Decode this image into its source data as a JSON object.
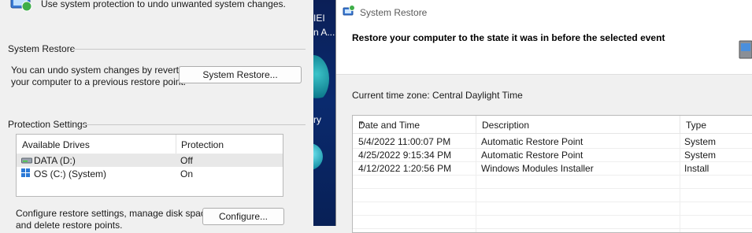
{
  "sysprops": {
    "intro": "Use system protection to undo unwanted system changes.",
    "restore_group_label": "System Restore",
    "restore_desc_line1": "You can undo system changes by reverting",
    "restore_desc_line2": "your computer to a previous restore point.",
    "restore_button": "System Restore...",
    "protection_group_label": "Protection Settings",
    "drives_headers": {
      "drive": "Available Drives",
      "protection": "Protection"
    },
    "drives": [
      {
        "name": "DATA (D:)",
        "protection": "Off",
        "icon": "drive-icon",
        "selected": true
      },
      {
        "name": "OS (C:) (System)",
        "protection": "On",
        "icon": "windows-drive-icon",
        "selected": false
      }
    ],
    "configure_desc_line1": "Configure restore settings, manage disk space,",
    "configure_desc_line2": "and delete restore points.",
    "configure_button": "Configure..."
  },
  "desktop": {
    "fragments": [
      "IEI",
      "n A...",
      "ry"
    ]
  },
  "restore_dialog": {
    "title": "System Restore",
    "heading": "Restore your computer to the state it was in before the selected event",
    "timezone": "Current time zone: Central Daylight Time",
    "columns": {
      "date": "Date and Time",
      "description": "Description",
      "type": "Type"
    },
    "rows": [
      {
        "date": "5/4/2022 11:00:07 PM",
        "description": "Automatic Restore Point",
        "type": "System"
      },
      {
        "date": "4/25/2022 9:15:34 PM",
        "description": "Automatic Restore Point",
        "type": "System"
      },
      {
        "date": "4/12/2022 1:20:56 PM",
        "description": "Windows Modules Installer",
        "type": "Install"
      }
    ]
  },
  "colors": {
    "accent": "#0067c0",
    "desktop_bg": "#0a2a6e",
    "selection": "#e8e8e8"
  }
}
